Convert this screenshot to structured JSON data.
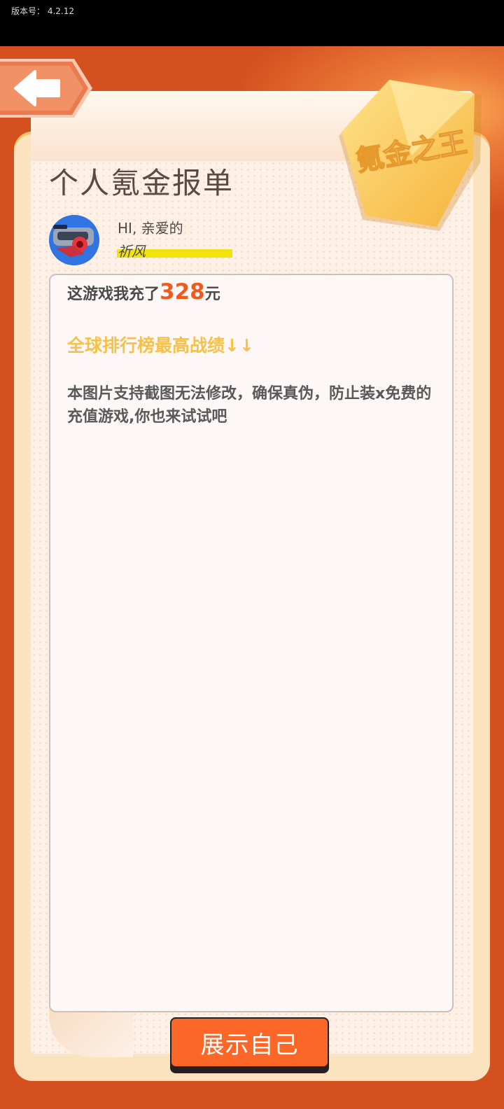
{
  "status_bar": {
    "version_text": "版本号：  4.2.12"
  },
  "header": {
    "title": "个人氪金报单",
    "badge_text": "氪金之王"
  },
  "user": {
    "greeting": "HI, 亲爱的",
    "name": "祈风"
  },
  "report": {
    "recharge_prefix": "这游戏我充了",
    "recharge_amount": "328",
    "recharge_unit": "元",
    "rank_heading": "全球排行榜最高战绩↓↓",
    "description": "本图片支持截图无法修改，确保真伪，防止装x免费的充值游戏,你也来试试吧"
  },
  "actions": {
    "show_button_label": "展示自己"
  },
  "colors": {
    "background": "#d4501f",
    "accent_orange": "#f05a1c",
    "button": "#fa6727",
    "gold": "#f6c148",
    "highlight": "#f3e30d"
  }
}
